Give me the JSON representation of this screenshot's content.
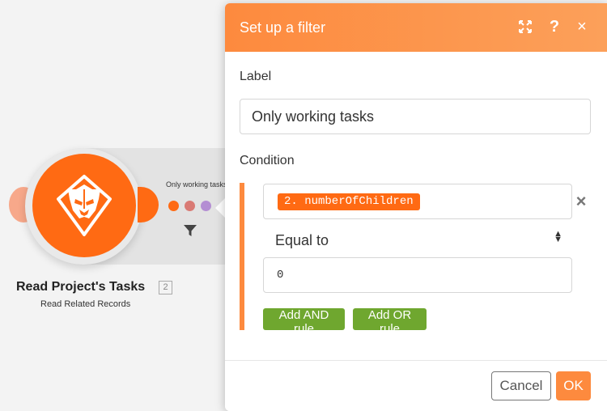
{
  "module": {
    "title": "Read Project's Tasks",
    "badge": "2",
    "subtitle": "Read Related Records",
    "route_label": "Only working tasks",
    "logo_icon": "lion-shield-icon",
    "filter_icon": "funnel-icon"
  },
  "dialog": {
    "title": "Set up a filter",
    "expand_icon": "expand-icon",
    "help_label": "?",
    "close_label": "×",
    "label_caption": "Label",
    "label_value": "Only working tasks",
    "condition_caption": "Condition",
    "operand_pill": "2. numberOfChildren",
    "remove_label": "×",
    "operator": "Equal to",
    "value": "0",
    "add_and_label": "Add AND rule",
    "add_or_label": "Add OR rule",
    "cancel_label": "Cancel",
    "ok_label": "OK"
  },
  "colors": {
    "brand_orange": "#ff6a13",
    "header_orange": "#fd8a3e",
    "rule_green": "#6fa72f"
  }
}
